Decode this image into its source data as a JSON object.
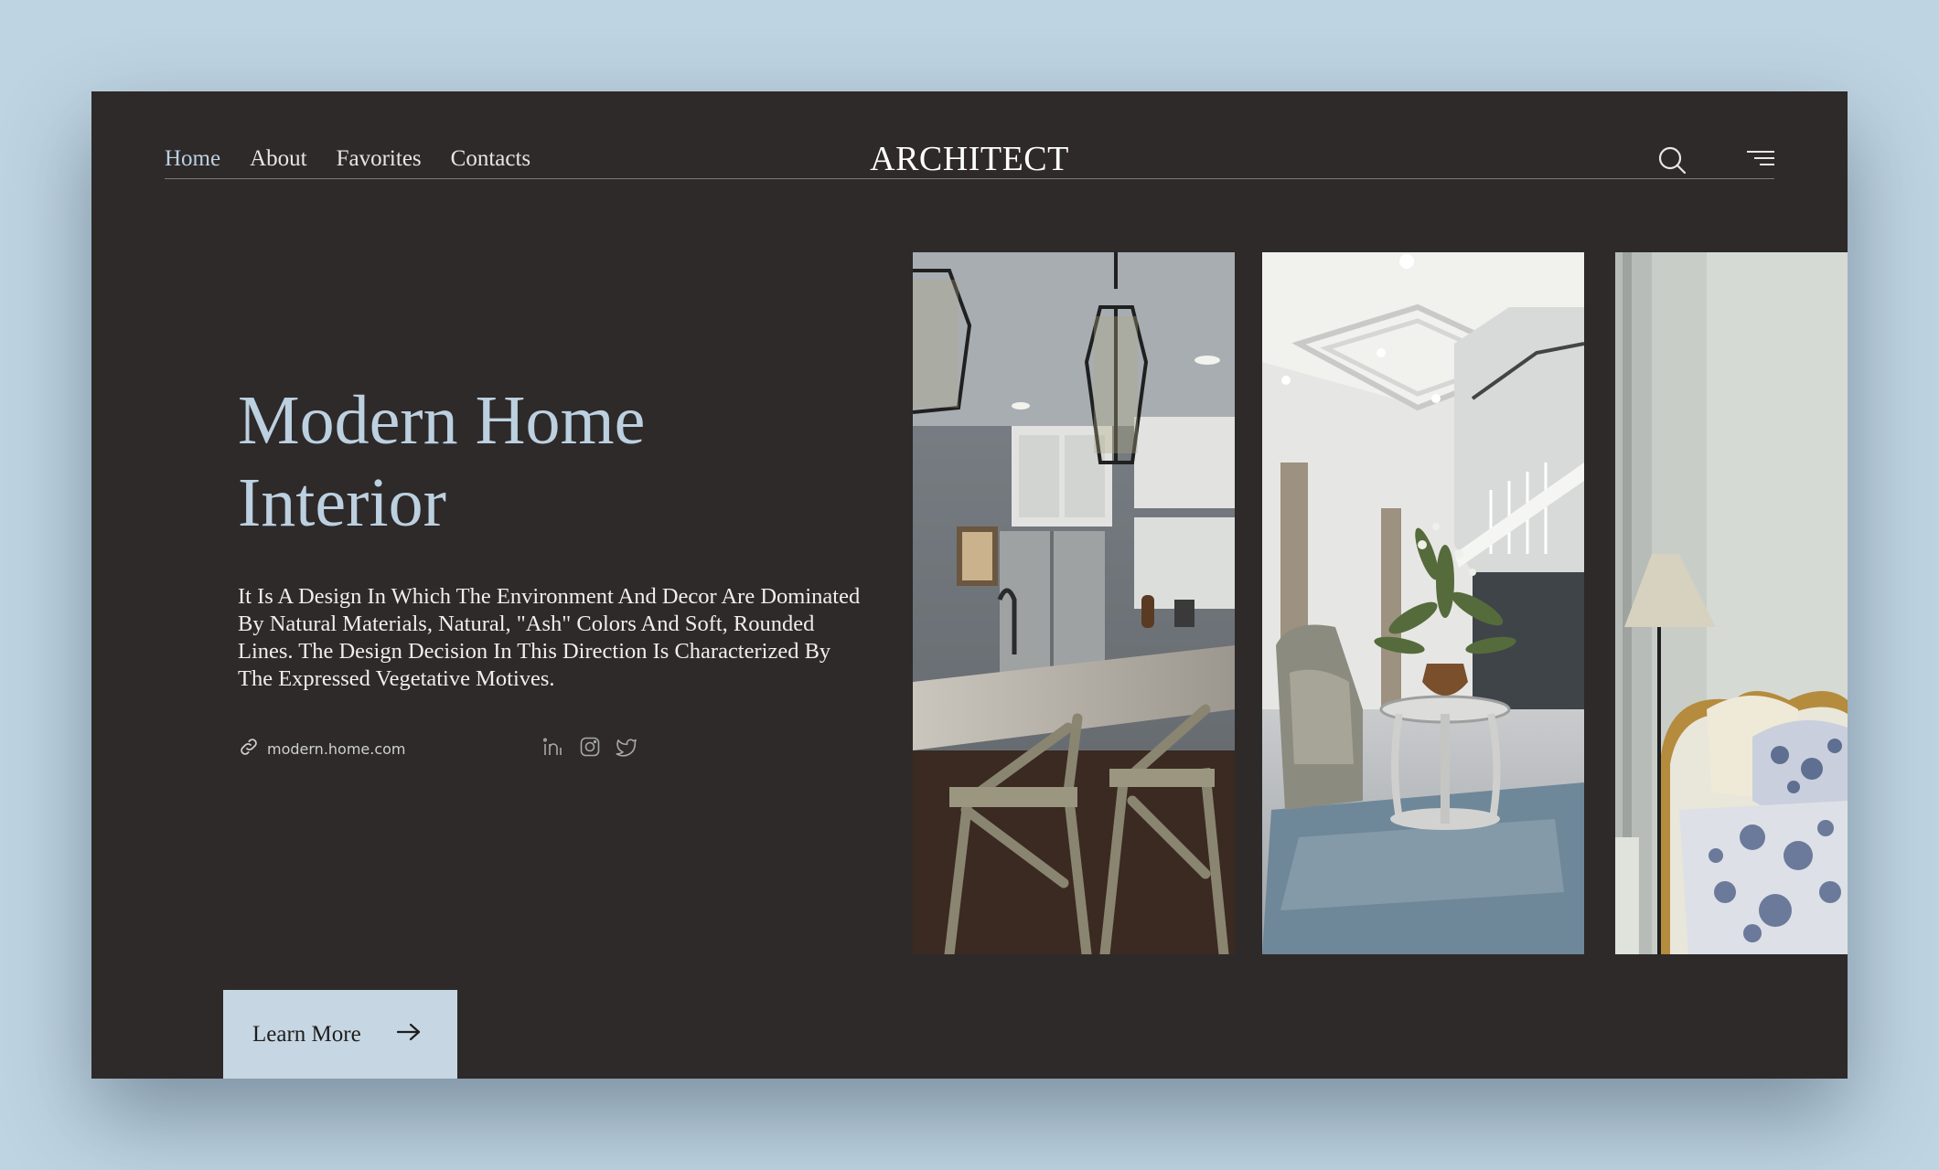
{
  "nav": {
    "items": [
      {
        "label": "Home"
      },
      {
        "label": "About"
      },
      {
        "label": "Favorites"
      },
      {
        "label": "Contacts"
      }
    ],
    "active": "Home"
  },
  "brand": "ARCHITECT",
  "hero": {
    "title_line1": "Modern Home",
    "title_line2": "Interior",
    "description": "It Is A Design In Which The Environment And Decor Are Dominated By Natural Materials, Natural, \"Ash\" Colors And Soft, Rounded Lines. The Design Decision In This Direction Is Characterized By The Expressed Vegetative Motives.",
    "link_text": "modern.home.com",
    "cta_label": "Learn More"
  },
  "icons": {
    "search": "search-icon",
    "menu": "menu-icon",
    "link": "link-icon",
    "social": [
      "linkedin-icon",
      "instagram-icon",
      "twitter-icon"
    ],
    "cta": "arrow-right-icon"
  },
  "gallery": [
    {
      "name": "kitchen-photo"
    },
    {
      "name": "living-room-photo"
    },
    {
      "name": "bedroom-photo"
    }
  ],
  "colors": {
    "page_bg": "#bfd4e2",
    "panel_bg": "#2e2a2a",
    "accent": "#bcd0e0",
    "button_bg": "#c6d6e3"
  }
}
